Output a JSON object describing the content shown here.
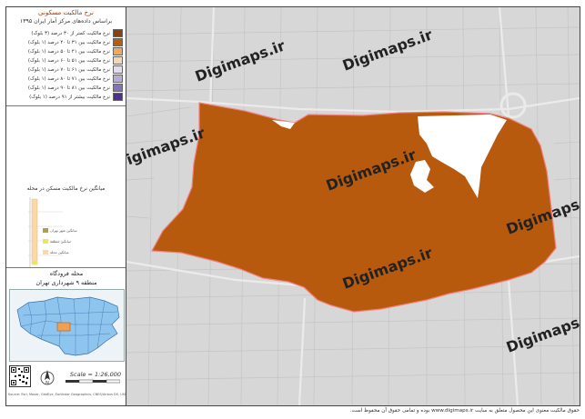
{
  "legend": {
    "title": "نرخ مالکیت مسکونی",
    "subtitle": "براساس داده‌های مرکز آمار ایران ۱۳۹۵",
    "classes": [
      {
        "label": "نرخ مالکیت کمتر از ۳۰ درصد (۳ بلوک)",
        "color": "#8a3f10"
      },
      {
        "label": "نرخ مالکیت بین ۳۱ تا ۴۰ درصد (۱ بلوک)",
        "color": "#b85c10"
      },
      {
        "label": "نرخ مالکیت بین ۴۱ تا ۵۰ درصد (۱ بلوک)",
        "color": "#f0a860"
      },
      {
        "label": "نرخ مالکیت بین ۵۱ تا ۶۰ درصد (۱ بلوک)",
        "color": "#f6d5b0"
      },
      {
        "label": "نرخ مالکیت بین ۶۱ تا ۷۰ درصد (۱ بلوک)",
        "color": "#e2dcef"
      },
      {
        "label": "نرخ مالکیت بین ۷۱ تا ۸۰ درصد (۱ بلوک)",
        "color": "#b9abd6"
      },
      {
        "label": "نرخ مالکیت بین ۸۱ تا ۹۰ درصد (۱ بلوک)",
        "color": "#8273b8"
      },
      {
        "label": "نرخ مالکیت بیشتر از ۹۱ درصد (۱ بلوک)",
        "color": "#4f2f8f"
      }
    ]
  },
  "chart": {
    "title": "میانگین نرخ مالکیت مسکن در محله",
    "legend": [
      {
        "label": "میانگین محله",
        "color": "#fad8a8"
      },
      {
        "label": "میانگین منطقه",
        "color": "#e8e860"
      },
      {
        "label": "میانگین شهر تهران",
        "color": "#a9a24a"
      }
    ]
  },
  "district": {
    "name": "محله فرودگاه",
    "region": "منطقه ۹ شهرداری تهران"
  },
  "map": {
    "scale_text": "Scale = 1:26,000",
    "watermark": "Digimaps.ir",
    "neighborhood_color": "#b85a0d",
    "outline_color": "#f28080"
  },
  "credit": "Source: Esri, Maxar, GeoEye, Earthstar Geographics, CNES/Airbus DS, USDA, USGS, AeroGRID, IGN",
  "footer": "حقوق مالکیت معنوی این محصول متعلق به سایت www.digimaps.ir بوده و تمامی حقوق آن محفوظ است."
}
